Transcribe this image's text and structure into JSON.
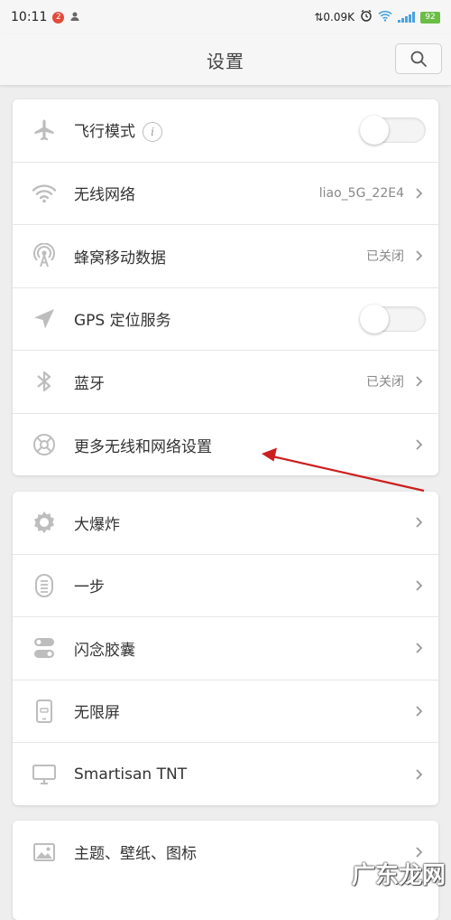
{
  "status_bar": {
    "time": "10:11",
    "notification_count": "2",
    "net_speed": "0.09K",
    "battery": "92",
    "user_icon": "person-icon",
    "alarm_icon": "alarm-icon",
    "wifi_icon": "wifi-icon",
    "signal_icon": "signal-icon"
  },
  "header": {
    "title": "设置",
    "search_icon": "search-icon"
  },
  "groups": [
    {
      "items": [
        {
          "icon": "airplane-icon",
          "label": "飞行模式",
          "control": "toggle",
          "on": false,
          "info": "i"
        },
        {
          "icon": "wifi-icon",
          "label": "无线网络",
          "value": "liao_5G_22E4",
          "control": "chevron"
        },
        {
          "icon": "cellular-antenna-icon",
          "label": "蜂窝移动数据",
          "value": "已关闭",
          "control": "chevron"
        },
        {
          "icon": "location-arrow-icon",
          "label": "GPS 定位服务",
          "control": "toggle",
          "on": false
        },
        {
          "icon": "bluetooth-icon",
          "label": "蓝牙",
          "value": "已关闭",
          "control": "chevron"
        },
        {
          "icon": "network-globe-icon",
          "label": "更多无线和网络设置",
          "control": "chevron"
        }
      ]
    },
    {
      "items": [
        {
          "icon": "big-bang-icon",
          "label": "大爆炸",
          "control": "chevron"
        },
        {
          "icon": "one-step-icon",
          "label": "一步",
          "control": "chevron"
        },
        {
          "icon": "capsule-icon",
          "label": "闪念胶囊",
          "control": "chevron"
        },
        {
          "icon": "phone-screen-icon",
          "label": "无限屏",
          "control": "chevron"
        },
        {
          "icon": "monitor-icon",
          "label": "Smartisan TNT",
          "control": "chevron"
        }
      ]
    },
    {
      "items": [
        {
          "icon": "image-icon",
          "label": "主题、壁纸、图标",
          "control": "chevron"
        }
      ]
    }
  ],
  "annotation": {
    "color": "#cc1f1f"
  },
  "watermark": {
    "text": "广东龙网"
  }
}
